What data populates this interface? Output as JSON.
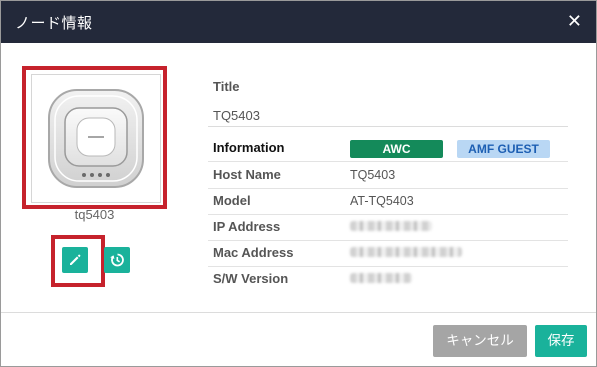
{
  "dialog": {
    "title": "ノード情報",
    "close_glyph": "✕"
  },
  "device": {
    "name": "tq5403",
    "image_icon": "access-point-icon"
  },
  "actions": {
    "edit_icon": "pencil-icon",
    "history_icon": "history-icon"
  },
  "info": {
    "title_label": "Title",
    "title_value": "TQ5403",
    "information_label": "Information",
    "badges": [
      "AWC",
      "AMF GUEST"
    ],
    "rows": [
      {
        "label": "Host Name",
        "value": "TQ5403"
      },
      {
        "label": "Model",
        "value": "AT-TQ5403"
      },
      {
        "label": "IP Address",
        "value": ""
      },
      {
        "label": "Mac Address",
        "value": ""
      },
      {
        "label": "S/W Version",
        "value": ""
      }
    ]
  },
  "footer": {
    "cancel_label": "キャンセル",
    "save_label": "保存"
  },
  "colors": {
    "titlebar": "#23293a",
    "accent": "#1ab29b",
    "highlight": "#c6222c",
    "awc_badge": "#148a5a",
    "guest_badge": "#b9d7f4",
    "cancel_button": "#a5a5a5"
  }
}
